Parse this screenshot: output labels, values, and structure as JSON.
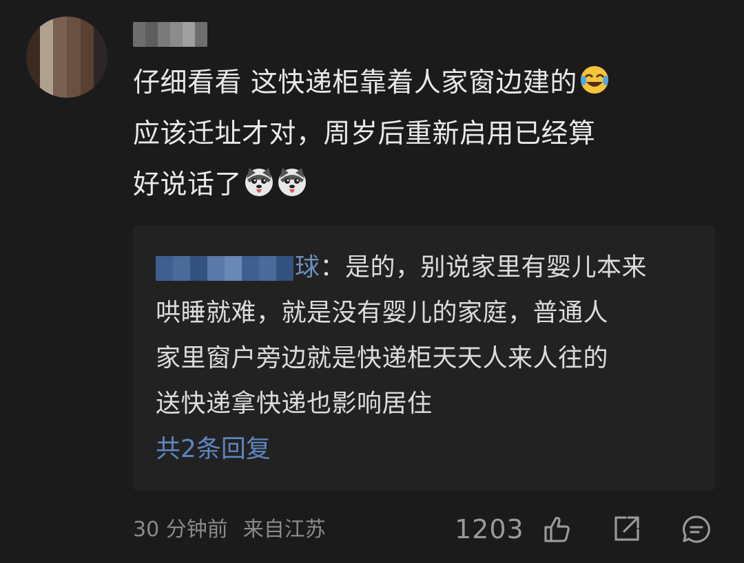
{
  "comment": {
    "text_line1": "仔细看看 这快递柜靠着人家窗边建的",
    "text_line2": "应该迁址才对，周岁后重新启用已经算",
    "text_line3": "好说话了",
    "emoji_1": "laughing-crying-emoji",
    "emoji_2": "husky-dog-emoji"
  },
  "reply": {
    "author_visible_tail": "球",
    "separator": "：",
    "text_line1": "是的，别说家里有婴儿本来",
    "text_line2": "哄睡就难，就是没有婴儿的家庭，普通人",
    "text_line3": "家里窗户旁边就是快递柜天天人来人往的",
    "text_line4": "送快递拿快递也影响居住",
    "more_label": "共2条回复"
  },
  "meta": {
    "time": "30 分钟前",
    "location": "来自江苏",
    "like_count": "1203"
  },
  "icons": {
    "like": "thumbs-up-icon",
    "share": "share-icon",
    "comment": "comment-icon"
  },
  "colors": {
    "background": "#1b1b1b",
    "reply_background": "#222222",
    "link_blue": "#5e86c0",
    "meta_gray": "#8a8a8a"
  }
}
